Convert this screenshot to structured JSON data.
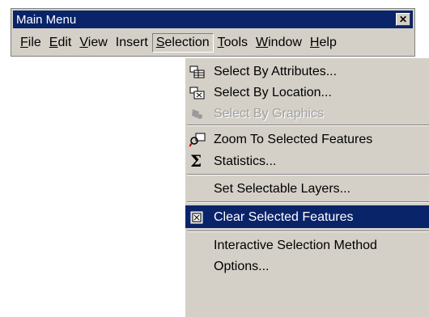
{
  "window": {
    "title": "Main Menu",
    "close_label": "✕"
  },
  "menubar": [
    {
      "acc": "F",
      "rest": "ile"
    },
    {
      "acc": "E",
      "rest": "dit"
    },
    {
      "acc": "V",
      "rest": "iew"
    },
    {
      "acc": "I",
      "rest": "nsert",
      "acc_hidden": true
    },
    {
      "acc": "S",
      "rest": "election"
    },
    {
      "acc": "T",
      "rest": "ools"
    },
    {
      "acc": "W",
      "rest": "indow"
    },
    {
      "acc": "H",
      "rest": "elp"
    }
  ],
  "dropdown": {
    "items": [
      {
        "label": "Select By Attributes...",
        "icon": "table-select-icon"
      },
      {
        "label": "Select By Location...",
        "icon": "location-select-icon"
      },
      {
        "label": "Select By Graphics",
        "icon": "graphics-select-icon",
        "disabled": true
      },
      {
        "label": "Zoom To Selected Features",
        "icon": "zoom-selected-icon"
      },
      {
        "label": "Statistics...",
        "icon": "sigma-icon"
      },
      {
        "label": "Set Selectable Layers..."
      },
      {
        "label": "Clear Selected Features",
        "icon": "clear-selection-icon",
        "highlighted": true
      },
      {
        "label": "Interactive Selection Method",
        "submenu": true
      },
      {
        "label": "Options..."
      }
    ]
  },
  "colors": {
    "highlight": "#0a246a",
    "face": "#d4d0c8"
  }
}
